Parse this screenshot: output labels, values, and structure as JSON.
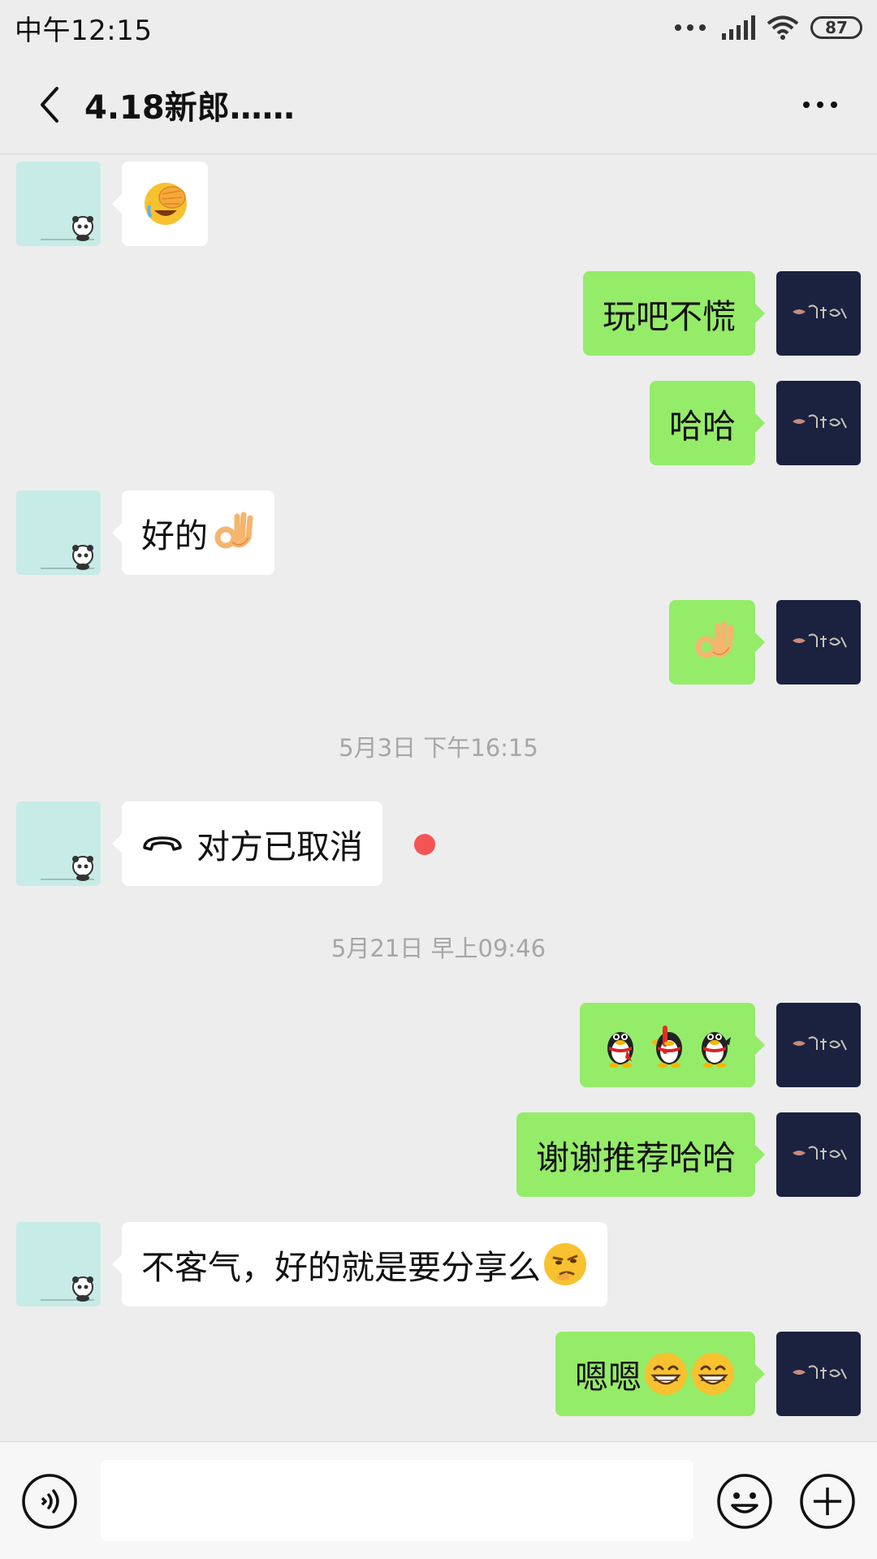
{
  "status_bar": {
    "time": "中午12:15",
    "battery": "87"
  },
  "header": {
    "title": "4.18新郎……"
  },
  "messages": [
    {
      "side": "left",
      "text": "",
      "emoji": "facepalm-laugh-emoji"
    },
    {
      "side": "right",
      "text": "玩吧不慌"
    },
    {
      "side": "right",
      "text": "哈哈"
    },
    {
      "side": "left",
      "text": "好的",
      "emoji": "ok-hand-emoji"
    },
    {
      "side": "right",
      "text": "",
      "emoji": "ok-hand-emoji"
    },
    {
      "type": "timestamp",
      "text": "5月3日 下午16:15"
    },
    {
      "side": "left",
      "text": "对方已取消",
      "icon": "phone-hangup-icon",
      "unread": true
    },
    {
      "type": "timestamp",
      "text": "5月21日 早上09:46"
    },
    {
      "side": "right",
      "text": "",
      "emoji": "penguin-emojis"
    },
    {
      "side": "right",
      "text": "谢谢推荐哈哈"
    },
    {
      "side": "left",
      "text": "不客气，好的就是要分享么",
      "emoji": "smirk-emoji"
    },
    {
      "side": "right",
      "text": "嗯嗯",
      "emoji": "grin-emoji x2"
    }
  ],
  "colors": {
    "background": "#ededed",
    "bubble_self": "#95ec69",
    "bubble_other": "#ffffff",
    "unread_dot": "#f45454",
    "self_avatar_bg": "#1a2240",
    "other_avatar_bg": "#c7ebe6"
  },
  "input_bar": {
    "placeholder": ""
  }
}
